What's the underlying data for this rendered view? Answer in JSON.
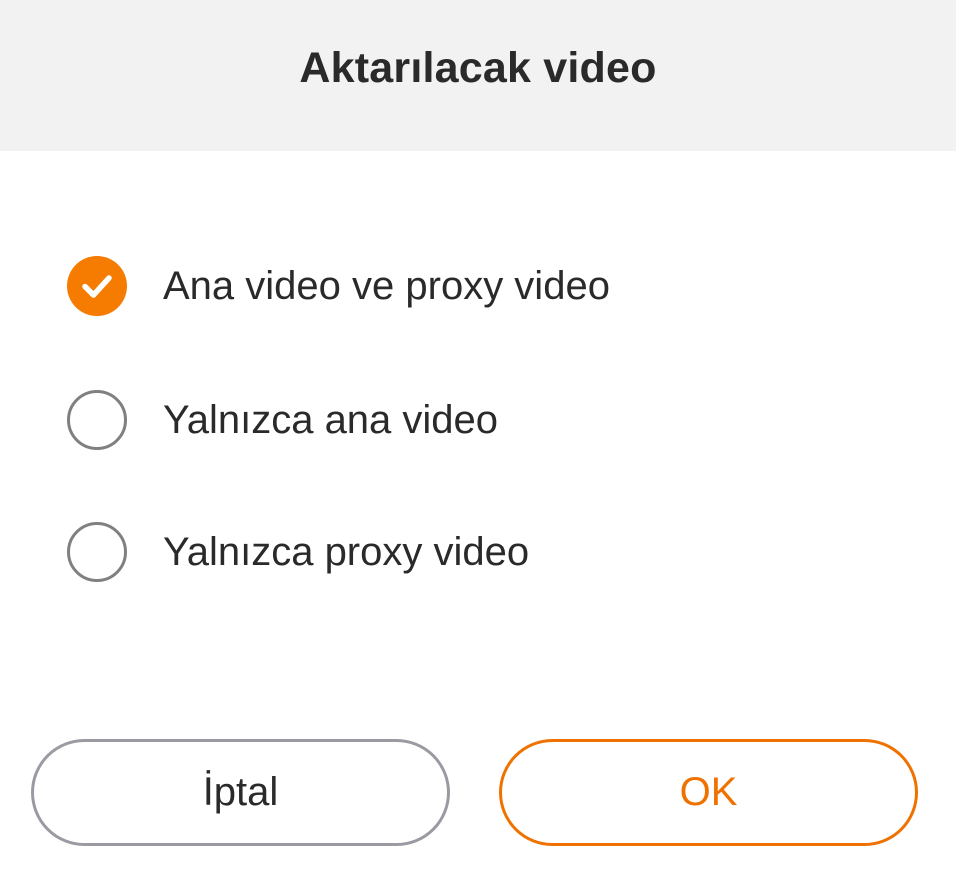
{
  "dialog": {
    "title": "Aktarılacak video"
  },
  "options": [
    {
      "label": "Ana video ve proxy video",
      "selected": true
    },
    {
      "label": "Yalnızca ana video",
      "selected": false
    },
    {
      "label": "Yalnızca proxy video",
      "selected": false
    }
  ],
  "buttons": {
    "cancel_label": "İptal",
    "ok_label": "OK"
  },
  "colors": {
    "accent": "#f57c00",
    "header_bg": "#f2f2f2",
    "text": "#2a2a2a",
    "radio_border": "#808080",
    "cancel_border": "#9a9aa2"
  },
  "icons": {
    "selected_radio": "checkmark-icon"
  }
}
